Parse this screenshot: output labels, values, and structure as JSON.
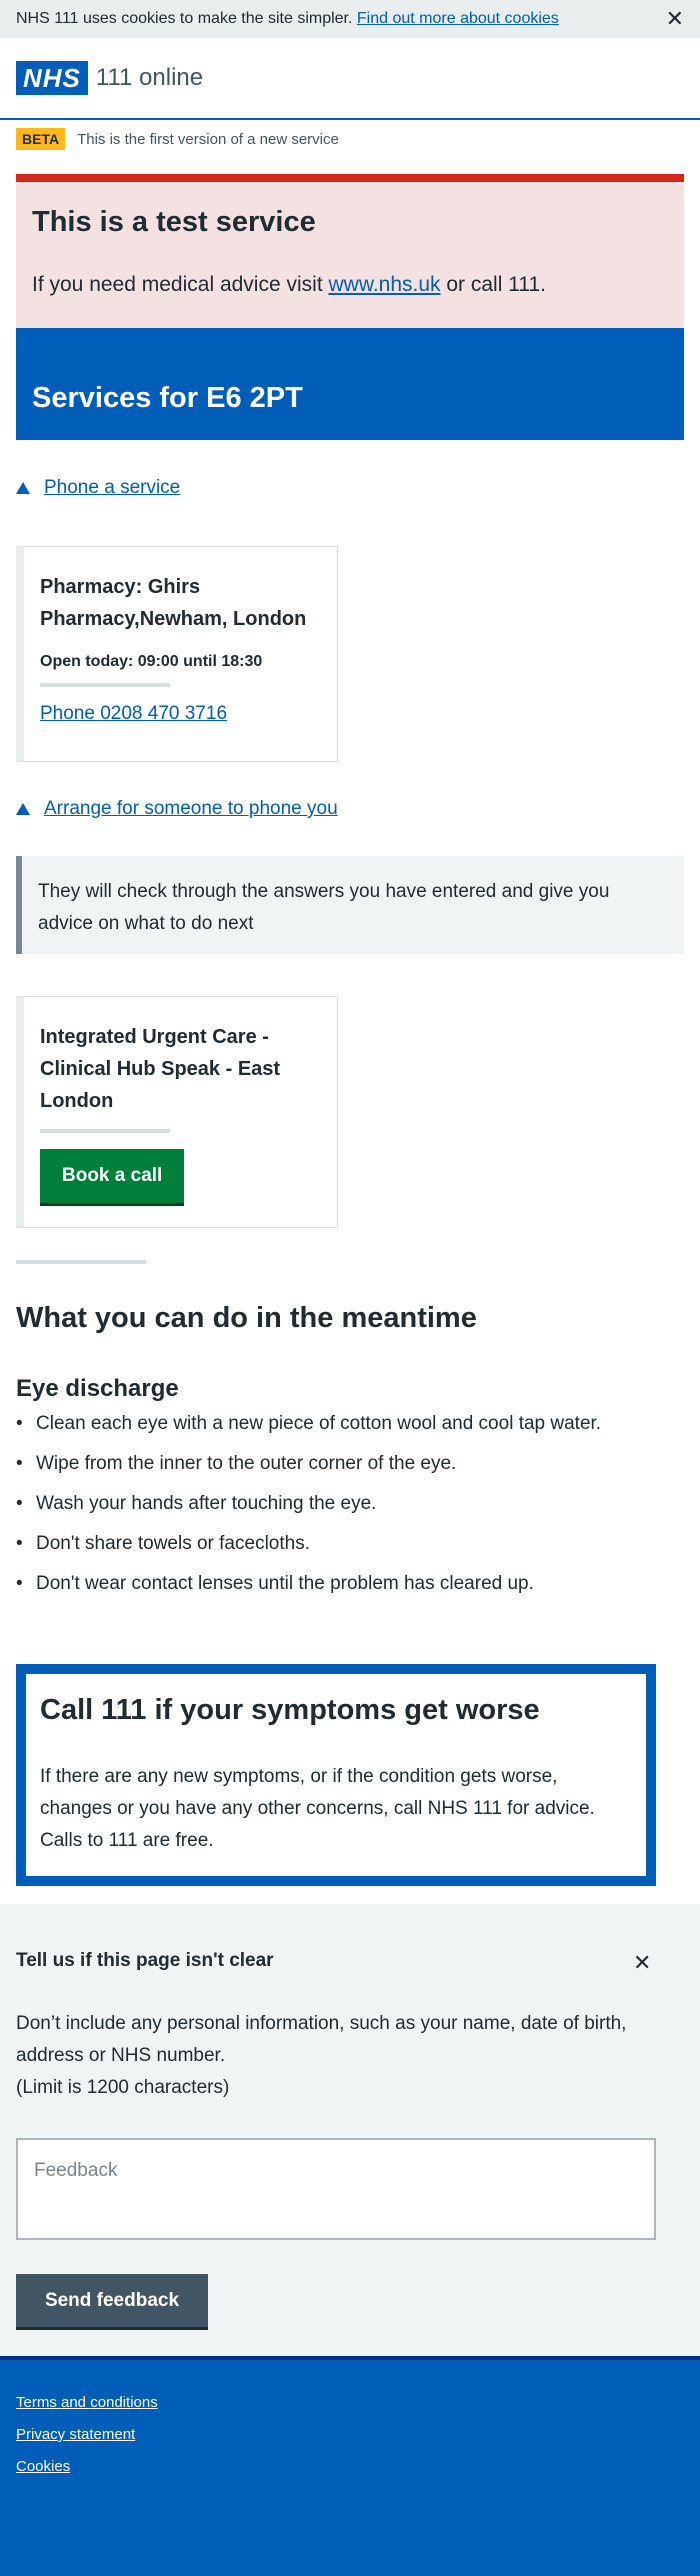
{
  "cookie_banner": {
    "message": "NHS 111 uses cookies to make the site simpler.",
    "link": "Find out more about cookies",
    "close_glyph": "✕"
  },
  "header": {
    "logo": "NHS",
    "service": "111 online"
  },
  "beta": {
    "tag": "BETA",
    "text": "This is the first version of a new service"
  },
  "test_notice": {
    "title": "This is a test service",
    "text_before": "If you need medical advice visit ",
    "link": "www.nhs.uk",
    "text_after": " or call 111."
  },
  "services_banner": "Services for E6 2PT",
  "phone_section": {
    "toggle": "Phone a service",
    "card": {
      "title": "Pharmacy: Ghirs Pharmacy,Newham, London",
      "open": "Open today: 09:00 until 18:30",
      "phone": "Phone 0208 470 3716"
    }
  },
  "callback_section": {
    "toggle": "Arrange for someone to phone you",
    "inset": "They will check through the answers you have entered and give you advice on what to do next",
    "card": {
      "title": "Integrated Urgent Care - Clinical Hub Speak - East London",
      "button": "Book a call"
    }
  },
  "meantime": {
    "title": "What you can do in the meantime",
    "subtitle": "Eye discharge",
    "items": [
      "Clean each eye with a new piece of cotton wool and cool tap water.",
      "Wipe from the inner to the outer corner of the eye.",
      "Wash your hands after touching the eye.",
      "Don't share towels or facecloths.",
      "Don't wear contact lenses until the problem has cleared up."
    ]
  },
  "care_card": {
    "title": "Call 111 if your symptoms get worse",
    "text": "If there are any new symptoms, or if the condition gets worse, changes or you have any other concerns, call NHS 111 for advice. Calls to 111 are free."
  },
  "feedback": {
    "title": "Tell us if this page isn't clear",
    "close_glyph": "✕",
    "line1": "Don’t include any personal information, such as your name, date of birth, address or NHS number.",
    "line2": "(Limit is 1200 characters)",
    "placeholder": "Feedback",
    "button": "Send feedback"
  },
  "footer": {
    "links": [
      "Terms and conditions",
      "Privacy statement",
      "Cookies"
    ]
  },
  "colors": {
    "nhs_blue": "#005eb8",
    "red": "#d5281b",
    "green": "#007f3b",
    "beta_yellow": "#ffb81c",
    "grey_bg": "#f0f4f5"
  }
}
